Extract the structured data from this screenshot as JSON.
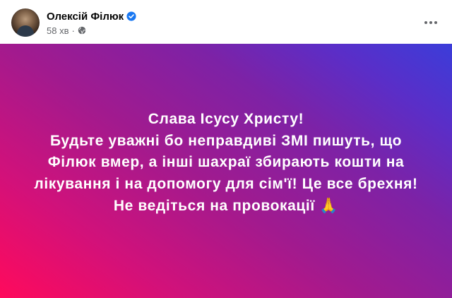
{
  "author": {
    "name": "Олексій Філюк",
    "verified": true
  },
  "meta": {
    "time": "58 хв",
    "separator": "·",
    "audience_icon": "globe-icon"
  },
  "menu": {
    "icon": "more-horizontal-icon"
  },
  "post": {
    "background_colors": [
      "#ff0a5c",
      "#a21a8e",
      "#3b3dd9"
    ],
    "lines": [
      "Слава Ісусу Христу!",
      "Будьте уважні бо неправдиві ЗМІ пишуть, що",
      "Філюк вмер, а інші шахраї збирають кошти на",
      "лікування і на допомогу для сім'ї! Це все брехня!",
      "Не ведіться на провокації"
    ],
    "trailing_emoji": "🙏"
  },
  "colors": {
    "verified_badge": "#1877f2",
    "meta_text": "#65676b",
    "name_text": "#050505"
  }
}
